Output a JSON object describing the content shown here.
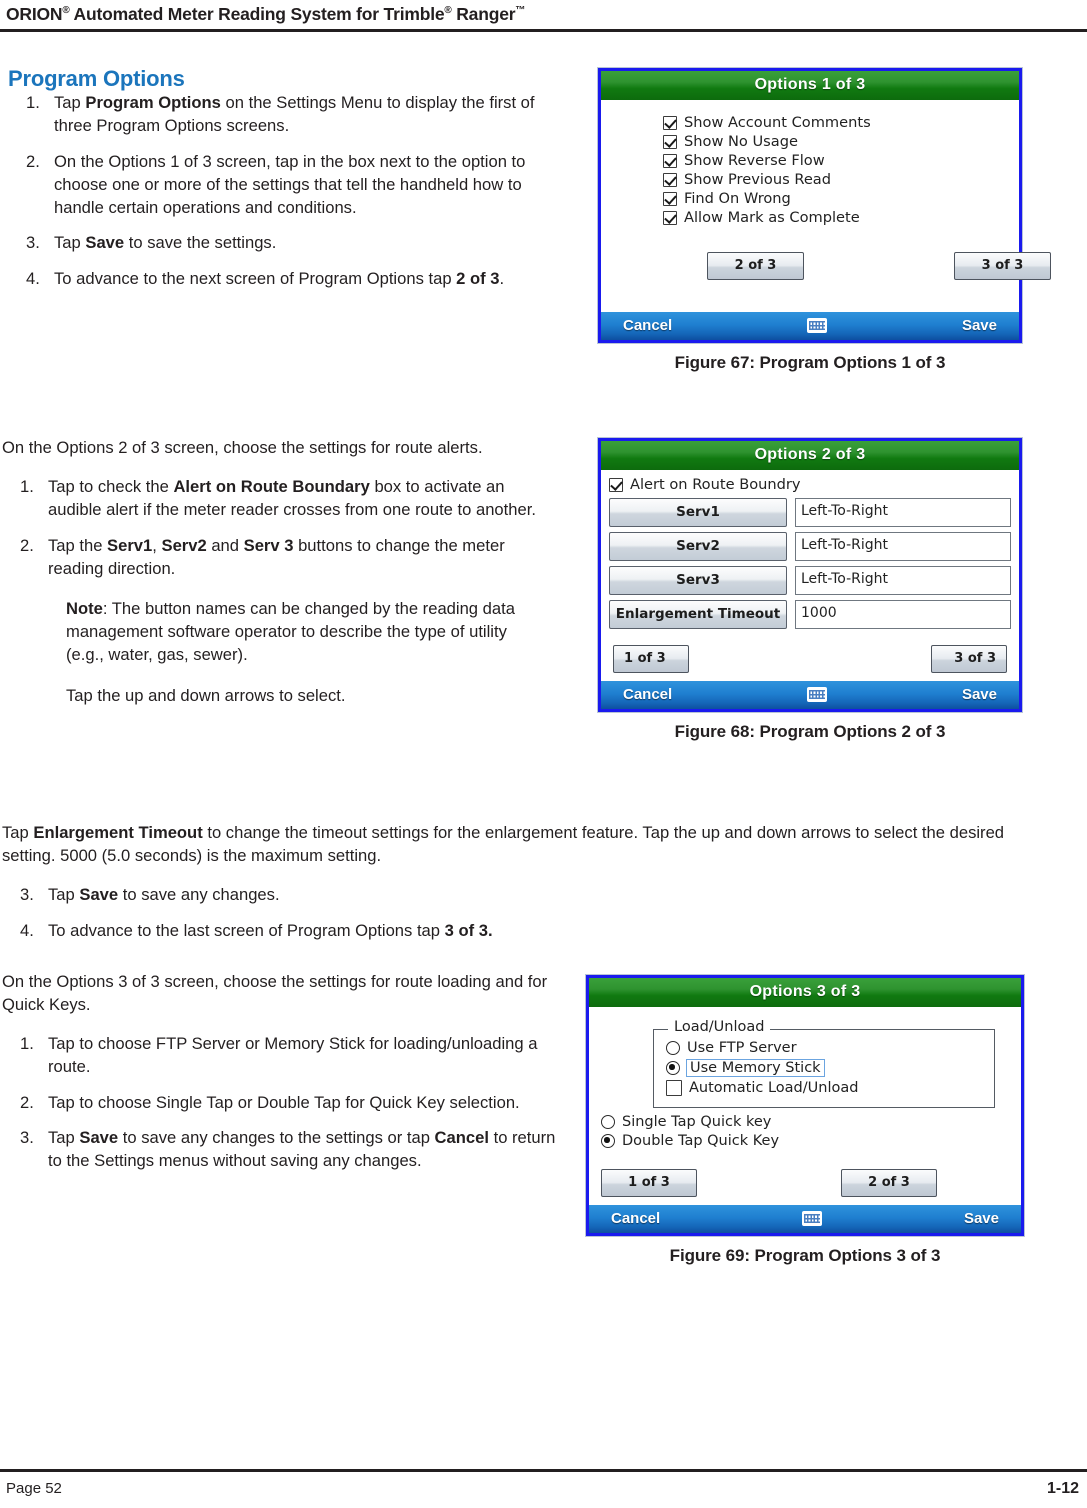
{
  "header": {
    "title_pre": "ORION",
    "title_sup1": "®",
    "title_mid": " Automated Meter Reading System for Trimble",
    "title_sup2": "®",
    "title_post": " Ranger",
    "title_tm": "™"
  },
  "footer": {
    "left": "Page 52",
    "right": "1-12"
  },
  "program_options": {
    "title": "Program Options",
    "steps": [
      {
        "num": "1.",
        "html": "Tap <b>Program Options</b> on the Settings Menu to display the first of three Program Options screens."
      },
      {
        "num": "2.",
        "html": "On the Options 1 of 3 screen, tap in the box next to the option to choose one or more of the settings that tell the handheld how to handle certain operations and conditions."
      },
      {
        "num": "3.",
        "html": "Tap <b>Save</b> to save the settings."
      },
      {
        "num": "4.",
        "html": "To advance to the next screen of Program Options tap <b>2 of 3</b>."
      }
    ]
  },
  "options2_intro": {
    "paragraph": "On the Options 2 of 3 screen, choose the settings for route alerts.",
    "steps": [
      {
        "num": "1.",
        "html": "Tap to check the <b>Alert on Route Boundary</b> box to activate an audible alert if the meter reader crosses from one route to another."
      },
      {
        "num": "2.",
        "html": "Tap the <b>Serv1</b>, <b>Serv2</b> and <b>Serv 3</b> buttons to change the meter reading direction."
      }
    ],
    "note": "<b>Note</b>: The button names can be changed by the reading data management software operator to describe the type of utility (e.g., water, gas, sewer).",
    "subnote": "Tap the up and down arrows to select."
  },
  "enlargement": {
    "paragraph": "Tap <b>Enlargement Timeout</b> to change the timeout settings for the enlargement feature. Tap the up and down arrows to select the desired setting. 5000 (5.0 seconds) is the maximum setting.",
    "steps": [
      {
        "num": "3.",
        "html": "Tap <b>Save</b> to save any changes."
      },
      {
        "num": "4.",
        "html": "To advance to the last screen of Program Options tap <b>3 of 3.</b>"
      }
    ]
  },
  "options3_intro": {
    "paragraph": "On the Options 3 of 3 screen, choose the settings for route loading and for Quick Keys.",
    "steps": [
      {
        "num": "1.",
        "html": "Tap to choose FTP Server or Memory Stick for loading/unloading a route."
      },
      {
        "num": "2.",
        "html": "Tap to choose Single Tap or Double Tap for Quick Key selection."
      },
      {
        "num": "3.",
        "html": "Tap <b>Save</b> to save any changes to the settings or tap <b>Cancel</b> to return to the Settings menus without saving any changes."
      }
    ]
  },
  "figure67": {
    "caption": "Figure 67:  Program Options 1 of 3",
    "screen": {
      "title": "Options 1 of 3",
      "checkboxes": [
        {
          "label": "Show Account Comments",
          "checked": true
        },
        {
          "label": "Show No Usage",
          "checked": true
        },
        {
          "label": "Show Reverse Flow",
          "checked": true
        },
        {
          "label": "Show Previous Read",
          "checked": true
        },
        {
          "label": "Find On Wrong",
          "checked": true
        },
        {
          "label": "Allow Mark as Complete",
          "checked": true
        }
      ],
      "nav_left": "2 of 3",
      "nav_right": "3 of 3",
      "cancel": "Cancel",
      "save": "Save",
      "keyboard_icon": "keyboard-icon"
    }
  },
  "figure68": {
    "caption": "Figure 68:  Program Options 2 of 3",
    "screen": {
      "title": "Options 2 of 3",
      "alert_checkbox": {
        "label": "Alert on Route Boundry",
        "checked": true
      },
      "rows": [
        {
          "button": "Serv1",
          "value": "Left-To-Right"
        },
        {
          "button": "Serv2",
          "value": "Left-To-Right"
        },
        {
          "button": "Serv3",
          "value": "Left-To-Right"
        },
        {
          "button": "Enlargement Timeout",
          "value": "1000"
        }
      ],
      "nav_left": "1 of 3",
      "nav_right": "3 of 3",
      "cancel": "Cancel",
      "save": "Save",
      "keyboard_icon": "keyboard-icon"
    }
  },
  "figure69": {
    "caption": "Figure 69:  Program Options 3 of 3",
    "screen": {
      "title": "Options 3 of 3",
      "group_label": "Load/Unload",
      "group_options": [
        {
          "type": "radio",
          "label": "Use FTP Server",
          "selected": false,
          "focused": false
        },
        {
          "type": "radio",
          "label": "Use Memory Stick",
          "selected": true,
          "focused": true
        },
        {
          "type": "checkbox",
          "label": "Automatic Load/Unload",
          "checked": false
        }
      ],
      "quick_key_options": [
        {
          "type": "radio",
          "label": "Single Tap Quick key",
          "selected": false
        },
        {
          "type": "radio",
          "label": "Double Tap Quick Key",
          "selected": true
        }
      ],
      "nav_left": "1 of 3",
      "nav_right": "2 of 3",
      "cancel": "Cancel",
      "save": "Save",
      "keyboard_icon": "keyboard-icon"
    }
  }
}
